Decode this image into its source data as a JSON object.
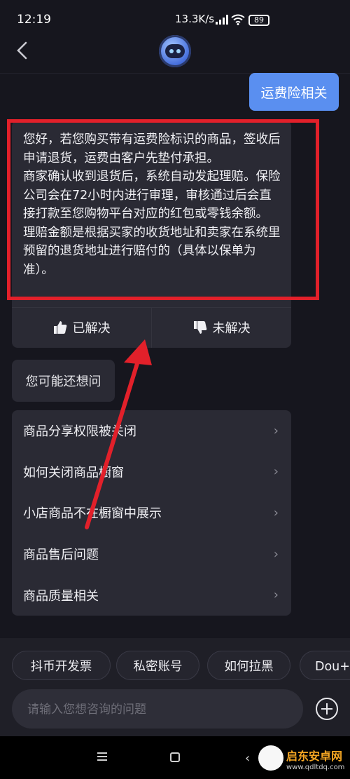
{
  "status_bar": {
    "time": "12:19",
    "network_speed": "13.3K/s",
    "battery": "89"
  },
  "header": {
    "back_icon": "chevron-left-icon",
    "bot_avatar": "robot-avatar"
  },
  "user_message": "运费险相关",
  "answer": {
    "paragraphs": [
      "您好，若您购买带有运费险标识的商品，签收后申请退货，运费由客户先垫付承担。",
      "商家确认收到退货后，系统自动发起理赔。保险公司会在72小时内进行审理，审核通过后会直接打款至您购物平台对应的红包或零钱余额。",
      "理赔金额是根据买家的收货地址和卖家在系统里预留的退货地址进行赔付的（具体以保单为准）。"
    ],
    "solved_label": "已解决",
    "unsolved_label": "未解决"
  },
  "may_ask_label": "您可能还想问",
  "suggestions": [
    {
      "label": "商品分享权限被关闭"
    },
    {
      "label": "如何关闭商品橱窗"
    },
    {
      "label": "小店商品不在橱窗中展示"
    },
    {
      "label": "商品售后问题"
    },
    {
      "label": "商品质量相关"
    }
  ],
  "quick_chips": [
    {
      "label": "抖币开发票"
    },
    {
      "label": "私密账号"
    },
    {
      "label": "如何拉黑"
    },
    {
      "label": "Dou+工"
    }
  ],
  "input": {
    "placeholder": "请输入您想咨询的问题"
  },
  "watermark": {
    "title": "启东安卓网",
    "url": "www.qdltdq.com"
  },
  "colors": {
    "background": "#16161e",
    "card": "#2a2a34",
    "user_bubble": "#5a8ff0",
    "highlight_red": "#e2202a"
  }
}
